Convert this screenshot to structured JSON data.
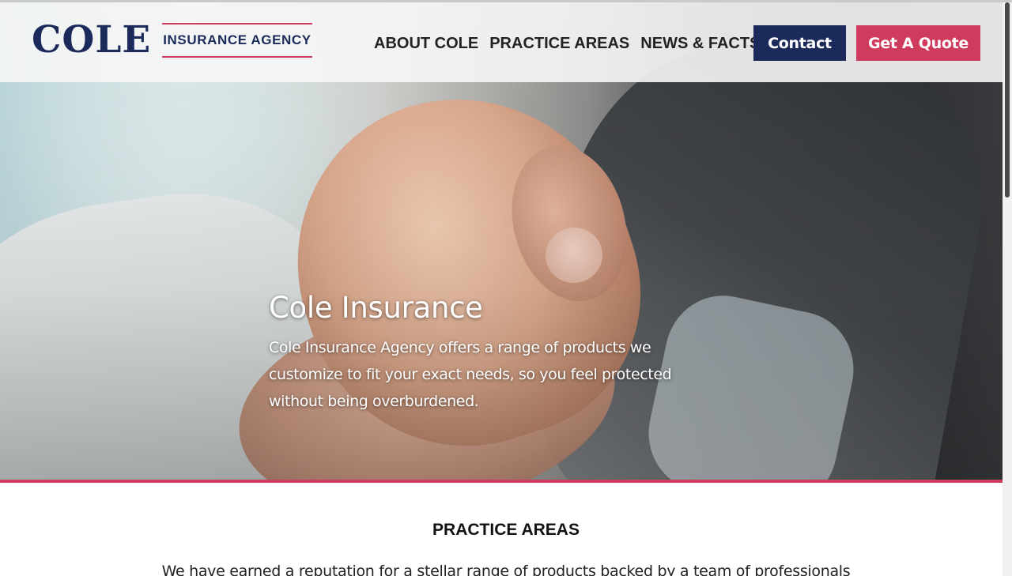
{
  "header": {
    "logo": {
      "word": "COLE",
      "subtitle": "INSURANCE AGENCY"
    },
    "nav": [
      {
        "label": "ABOUT COLE"
      },
      {
        "label": "PRACTICE AREAS"
      },
      {
        "label": "NEWS & FACTS"
      }
    ],
    "contact_label": "Contact",
    "quote_label": "Get A Quote"
  },
  "hero": {
    "title": "Cole Insurance",
    "description": "Cole Insurance Agency offers a range of products we customize to fit your exact needs, so you feel protected without being overburdened."
  },
  "practice_areas": {
    "heading": "PRACTICE AREAS",
    "intro": "We have earned a reputation for a stellar range of products backed by a team of professionals"
  },
  "colors": {
    "brand_navy": "#1c2a5b",
    "accent_red": "#cf3b5c",
    "header_bg": "#f6f6f6",
    "text_dark": "#222222"
  },
  "icons": {
    "scrollbar": "vertical-scrollbar"
  }
}
